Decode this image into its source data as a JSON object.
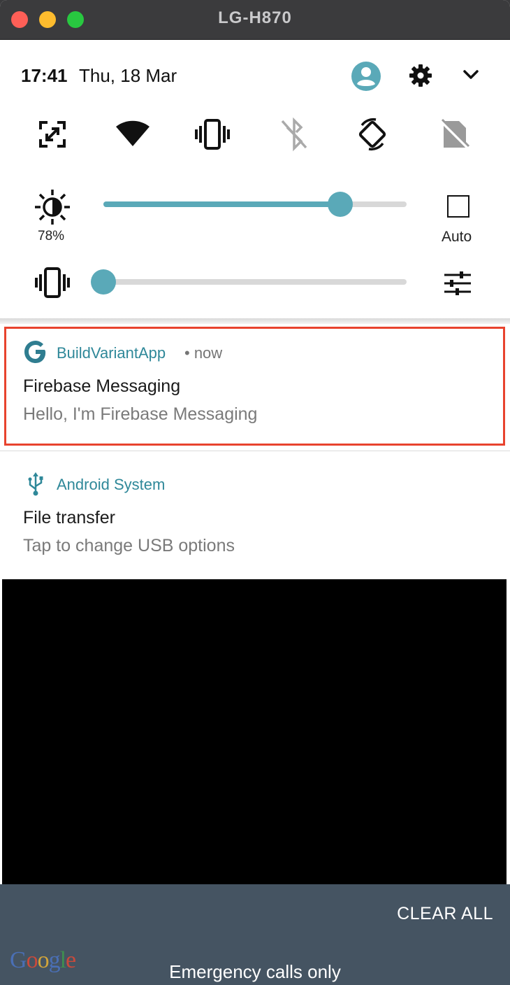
{
  "window": {
    "title": "LG-H870"
  },
  "status": {
    "time": "17:41",
    "date": "Thu, 18 Mar"
  },
  "header_icons": [
    "user-account-icon",
    "gear-icon",
    "chevron-down-icon"
  ],
  "tiles": [
    "screen-capture-icon",
    "wifi-icon",
    "vibrate-icon",
    "bluetooth-off-icon",
    "auto-rotate-icon",
    "no-sim-icon"
  ],
  "brightness": {
    "percent_label": "78%",
    "level": 0.78,
    "auto_label": "Auto"
  },
  "volume": {
    "level": 0.0
  },
  "notifications": [
    {
      "app": "BuildVariantApp",
      "time": "• now",
      "title": "Firebase Messaging",
      "text": "Hello, I'm Firebase Messaging"
    },
    {
      "app": "Android System",
      "title": "File transfer",
      "text": "Tap to change USB options"
    }
  ],
  "footer": {
    "clear_all": "CLEAR ALL",
    "emergency": "Emergency calls only",
    "logo": "Google"
  },
  "colors": {
    "accent": "#5aa9b8",
    "app_name": "#2f8899",
    "highlight": "#e8432e",
    "footer_bg": "#455462"
  }
}
